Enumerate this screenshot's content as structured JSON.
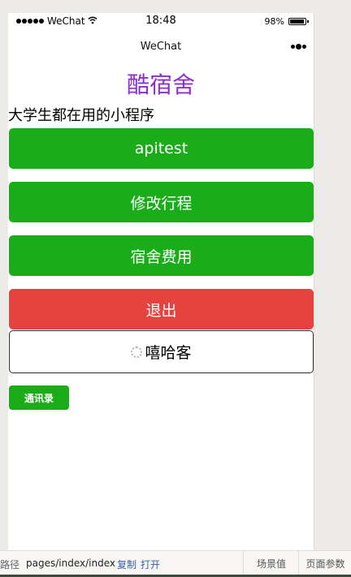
{
  "status_bar": {
    "carrier": "WeChat",
    "time": "18:48",
    "battery": "98%"
  },
  "nav": {
    "title": "WeChat"
  },
  "page": {
    "title": "酷宿舍",
    "subtitle": "大学生都在用的小程序",
    "buttons": [
      {
        "label": "apitest"
      },
      {
        "label": "修改行程"
      },
      {
        "label": "宿舍费用"
      },
      {
        "label": "退出"
      },
      {
        "label": "嘻哈客"
      }
    ],
    "small_button": "通讯录"
  },
  "bottom_bar": {
    "path_label": "路径",
    "path": "pages/index/index",
    "copy": "复制",
    "open": "打开",
    "tab_scene": "场景值",
    "tab_params": "页面参数"
  },
  "colors": {
    "primary_green": "#1aad19",
    "warn_red": "#e64340",
    "title_purple": "#8b2fd1"
  }
}
